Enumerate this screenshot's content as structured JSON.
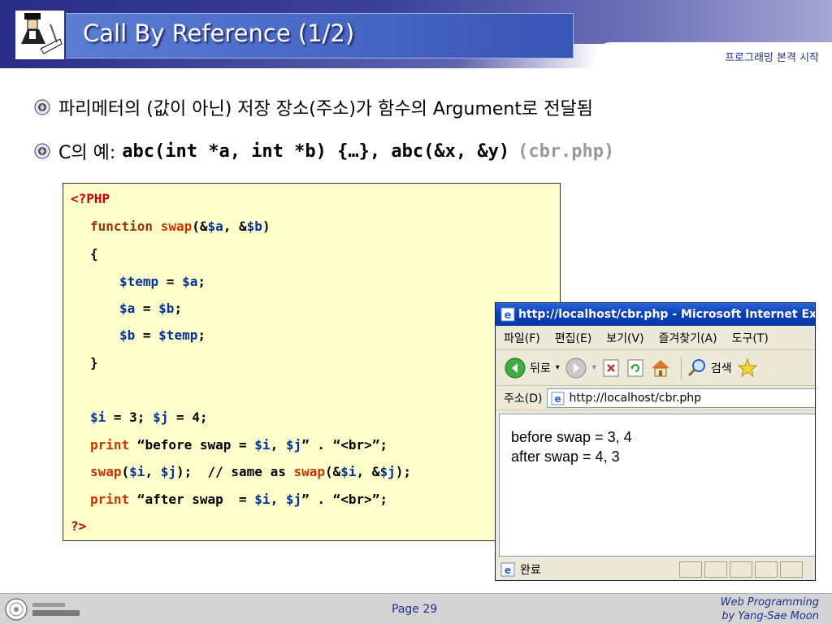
{
  "header": {
    "title": "Call By Reference (1/2)",
    "subtitle": "프로그래밍 본격 시작"
  },
  "bullets": [
    {
      "text": "파리메터의 (값이 아닌) 저장 장소(주소)가 함수의 Argument로 전달됨"
    },
    {
      "text": "C의 예:",
      "code": "abc(int *a, int *b) {…}, abc(&x, &y)",
      "file": "(cbr.php)"
    }
  ],
  "code": {
    "open_tag": "<?PHP",
    "l1_kw": "function",
    "l1_fn": "swap",
    "l1_p1": "(&",
    "l1_v1": "$a",
    "l1_p2": ", &",
    "l1_v2": "$b",
    "l1_p3": ")",
    "l2": "{",
    "l3_v1": "$temp",
    "l3_op": " = ",
    "l3_v2": "$a",
    "l3_end": ";",
    "l4_v1": "$a",
    "l4_op": " = ",
    "l4_v2": "$b",
    "l4_end": ";",
    "l5_v1": "$b",
    "l5_op": " = ",
    "l5_v2": "$temp",
    "l5_end": ";",
    "l6": "}",
    "l7_v1": "$i",
    "l7_a": " = 3; ",
    "l7_v2": "$j",
    "l7_b": " = 4;",
    "l8_kw": "print",
    "l8_a": " “before swap = ",
    "l8_v1": "$i",
    "l8_b": ", ",
    "l8_v2": "$j",
    "l8_c": "” . “<br>”;",
    "l9_fn": "swap",
    "l9_a": "(",
    "l9_v1": "$i",
    "l9_b": ", ",
    "l9_v2": "$j",
    "l9_c": ");  // same as ",
    "l9_fn2": "swap",
    "l9_d": "(&",
    "l9_v3": "$i",
    "l9_e": ", &",
    "l9_v4": "$j",
    "l9_f": ");",
    "l10_kw": "print",
    "l10_a": " “after swap  = ",
    "l10_v1": "$i",
    "l10_b": ", ",
    "l10_v2": "$j",
    "l10_c": "” . “<br>”;",
    "close_tag": "?>"
  },
  "browser": {
    "title": "http://localhost/cbr.php - Microsoft Internet Explorer",
    "menu": [
      "파일(F)",
      "편집(E)",
      "보기(V)",
      "즐겨찾기(A)",
      "도구(T)"
    ],
    "toolbar": {
      "back": "뒤로",
      "search": "검색"
    },
    "address_label": "주소(D)",
    "address_value": "http://localhost/cbr.php",
    "output": [
      "before swap = 3, 4",
      "after swap = 4, 3"
    ],
    "status": "완료"
  },
  "footer": {
    "page": "Page 29",
    "credit_line1": "Web Programming",
    "credit_line2": "by Yang-Sae Moon"
  }
}
